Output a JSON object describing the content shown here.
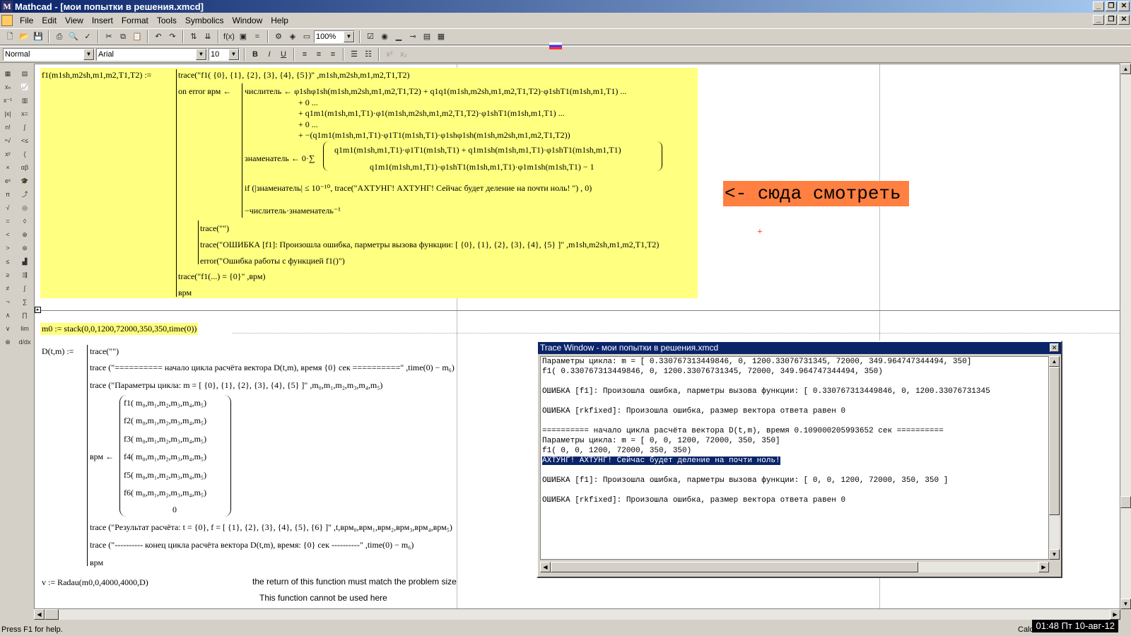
{
  "window": {
    "title": "Mathcad - [мои попытки в решения.xmcd]",
    "app_icon_letter": "M"
  },
  "menu": [
    "File",
    "Edit",
    "View",
    "Insert",
    "Format",
    "Tools",
    "Symbolics",
    "Window",
    "Help"
  ],
  "toolbar": {
    "zoom": "100%",
    "style": "Normal",
    "font": "Arial",
    "size": "10",
    "bold": "B",
    "italic": "I",
    "underline": "U"
  },
  "statusbar": {
    "help": "Press F1 for help.",
    "mode": "Calc",
    "clock": "01:48 Пт 10-авг-12"
  },
  "annotation": "<- сюда смотреть",
  "f1": {
    "def": "f1(m1sh,m2sh,m1,m2,T1,T2) :=",
    "l1": "trace(\"f1( {0}, {1}, {2}, {3}, {4}, {5})\" ,m1sh,m2sh,m1,m2,T1,T2)",
    "l2": "on error врм ←",
    "l3": "числитель ← φ1shφ1sh(m1sh,m2sh,m1,m2,T1,T2) + q1q1(m1sh,m2sh,m1,m2,T1,T2)·φ1shT1(m1sh,m1,T1) ...",
    "l4": "+ 0 ...",
    "l5": "+ q1m1(m1sh,m1,T1)·φ1(m1sh,m2sh,m1,m2,T1,T2)·φ1shT1(m1sh,m1,T1) ...",
    "l6": "+ 0 ...",
    "l7": "+ −(q1m1(m1sh,m1,T1)·φ1T1(m1sh,T1)·φ1shφ1sh(m1sh,m2sh,m1,m2,T1,T2))",
    "l8a": "знаменатель ← 0·∑",
    "l8b": "q1m1(m1sh,m1,T1)·φ1T1(m1sh,T1) + q1m1sh(m1sh,m1,T1)·φ1shT1(m1sh,m1,T1)",
    "l8c": "q1m1(m1sh,m1,T1)·φ1shT1(m1sh,m1,T1)·φ1m1sh(m1sh,T1) − 1",
    "l9": "if (|знаменатель| ≤ 10⁻¹⁰, trace(\"АХТУНГ! АХТУНГ! Сейчас будет деление на почти ноль! \") , 0)",
    "l10": "−числитель·знаменатель⁻¹",
    "l11": "trace(\"\")",
    "l12": "trace(\"ОШИБКА [f1]: Произошла ошибка, парметры вызова функции: [ {0}, {1}, {2}, {3}, {4}, {5} ]\" ,m1sh,m2sh,m1,m2,T1,T2)",
    "l13": "error(\"Ошибка работы с функцией f1()\")",
    "l14": "trace(\"f1(...) = {0}\" ,врм)",
    "l15": "врм"
  },
  "m0": "m0 := stack(0,0,1200,72000,350,350,time(0))",
  "D": {
    "def": "D(t,m) :=",
    "l1": "trace(\"\")",
    "l2": "trace (\"========== начало цикла расчёта вектора D(t,m), время {0} сек ==========\" ,time(0) − m₆)",
    "l3": "trace (\"Параметры цикла: m = [ {0}, {1}, {2}, {3}, {4}, {5} ]\" ,m₀,m₁,m₂,m₃,m₄,m₅)",
    "vrm": "врм ←",
    "rows": [
      "f1( m₀,m₁,m₂,m₃,m₄,m₅)",
      "f2( m₀,m₁,m₂,m₃,m₄,m₅)",
      "f3( m₀,m₁,m₂,m₃,m₄,m₅)",
      "f4( m₀,m₁,m₂,m₃,m₄,m₅)",
      "f5( m₀,m₁,m₂,m₃,m₄,m₅)",
      "f6( m₀,m₁,m₂,m₃,m₄,m₅)",
      "0"
    ],
    "l4": "trace (\"Результат расчёта: t = {0}, f = [ {1}, {2}, {3}, {4}, {5}, {6} ]\" ,t,врм₀,врм₁,врм₂,врм₃,врм₄,врм₅)",
    "l5": "trace (\"---------- конец цикла расчёта вектора D(t,m), время: {0} сек ----------\" ,time(0) − m₆)",
    "l6": "врм"
  },
  "v": "v := Radau(m0,0,4000,4000,D)",
  "err1": "the return of this function must match the problem size",
  "err2": "This function cannot be used here",
  "trace": {
    "title": "Trace Window - мои попытки в решения.xmcd",
    "lines": [
      "Параметры цикла: m = [ 0.330767313449846, 0, 1200.33076731345, 72000, 349.964747344494, 350]",
      "f1( 0.330767313449846, 0, 1200.33076731345, 72000, 349.964747344494, 350)",
      "",
      "ОШИБКА [f1]: Произошла ошибка, парметры вызова функции: [ 0.330767313449846, 0, 1200.33076731345",
      "",
      "ОШИБКА [rkfixed]: Произошла ошибка, размер вектора ответа равен 0",
      "",
      "========== начало цикла расчёта вектора D(t,m), время 0.109000205993652 сек ==========",
      "Параметры цикла: m = [ 0, 0, 1200, 72000, 350, 350]",
      "f1( 0, 0, 1200, 72000, 350, 350)",
      "АХТУНГ! АХТУНГ! Сейчас будет деление на почти ноль!",
      "",
      "ОШИБКА [f1]: Произошла ошибка, парметры вызова функции: [ 0, 0, 1200, 72000, 350, 350 ]",
      "",
      "ОШИБКА [rkfixed]: Произошла ошибка, размер вектора ответа равен 0"
    ],
    "highlight_index": 10
  }
}
